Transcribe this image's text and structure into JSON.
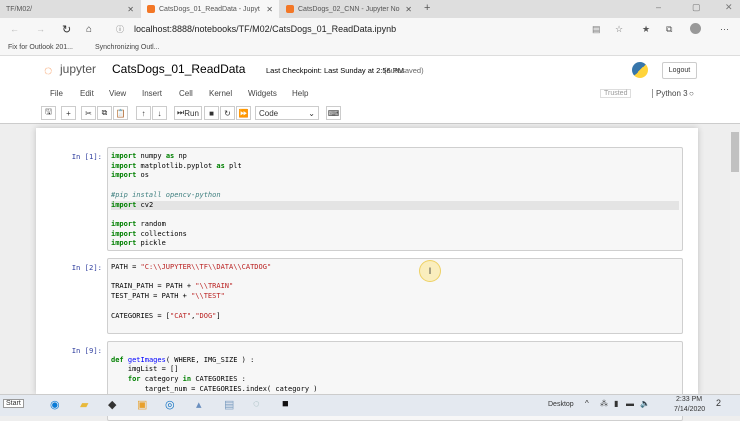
{
  "browser": {
    "tabs": [
      {
        "label": "TF/M02/",
        "active": false
      },
      {
        "label": "CatsDogs_01_ReadData - Jupyt",
        "active": true
      },
      {
        "label": "CatsDogs_02_CNN - Jupyter No",
        "active": false
      }
    ],
    "url": "localhost:8888/notebooks/TF/M02/CatsDogs_01_ReadData.ipynb",
    "bookmarks": [
      "Fix for Outlook 201...",
      "Synchronizing Outl..."
    ]
  },
  "jupyter": {
    "logo": "jupyter",
    "title": "CatsDogs_01_ReadData",
    "checkpoint": "Last Checkpoint: Last Sunday at 2:56 PM",
    "autosave": "(autosaved)",
    "logout": "Logout",
    "menu": [
      "File",
      "Edit",
      "View",
      "Insert",
      "Cell",
      "Kernel",
      "Widgets",
      "Help"
    ],
    "trusted": "Trusted",
    "kernel": "Python 3",
    "toolbar": {
      "run": "Run",
      "cell_type": "Code"
    }
  },
  "cells": [
    {
      "prompt": "In [1]:",
      "lines": [
        "import numpy as np",
        "import matplotlib.pyplot as plt",
        "import os",
        "",
        "#pip install opencv-python",
        "import cv2",
        "",
        "import random",
        "import collections",
        "import pickle"
      ]
    },
    {
      "prompt": "In [2]:",
      "lines": [
        "PATH = \"C:\\\\JUPYTER\\\\TF\\\\DATA\\\\CATDOG\"",
        "",
        "TRAIN_PATH = PATH + \"\\\\TRAIN\"",
        "TEST_PATH = PATH + \"\\\\TEST\"",
        "",
        "CATEGORIES = [\"CAT\",\"DOG\"]"
      ]
    },
    {
      "prompt": "In [9]:",
      "lines": [
        "",
        "def getImages( WHERE, IMG_SIZE ) :",
        "    imgList = []",
        "    for category in CATEGORIES :",
        "        target_num = CATEGORIES.index( category )"
      ]
    }
  ],
  "taskbar": {
    "start": "Start",
    "desktop": "Desktop",
    "time": "2:33 PM",
    "date": "7/14/2020",
    "notifications": "2"
  }
}
